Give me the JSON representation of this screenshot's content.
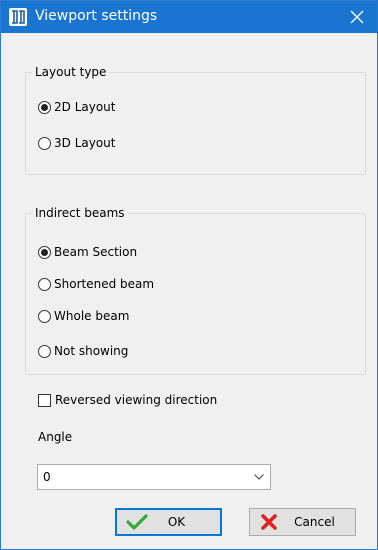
{
  "window": {
    "title": "Viewport settings",
    "icons": {
      "app": "viewport-app-icon",
      "close": "close-icon"
    },
    "colors": {
      "titlebar": "#1a75d1",
      "body": "#f0f0f0"
    }
  },
  "layout_type": {
    "legend": "Layout type",
    "options": [
      {
        "label": "2D Layout",
        "checked": true
      },
      {
        "label": "3D Layout",
        "checked": false
      }
    ]
  },
  "indirect_beams": {
    "legend": "Indirect beams",
    "options": [
      {
        "label": "Beam Section",
        "checked": true
      },
      {
        "label": "Shortened beam",
        "checked": false
      },
      {
        "label": "Whole beam",
        "checked": false
      },
      {
        "label": "Not showing",
        "checked": false
      }
    ]
  },
  "reversed": {
    "label": "Reversed viewing direction",
    "checked": false
  },
  "angle": {
    "label": "Angle",
    "value": "0"
  },
  "buttons": {
    "ok": {
      "label": "OK",
      "icon": "checkmark-icon",
      "color": "#3aa63a"
    },
    "cancel": {
      "label": "Cancel",
      "icon": "red-x-icon",
      "color": "#e02020"
    }
  }
}
